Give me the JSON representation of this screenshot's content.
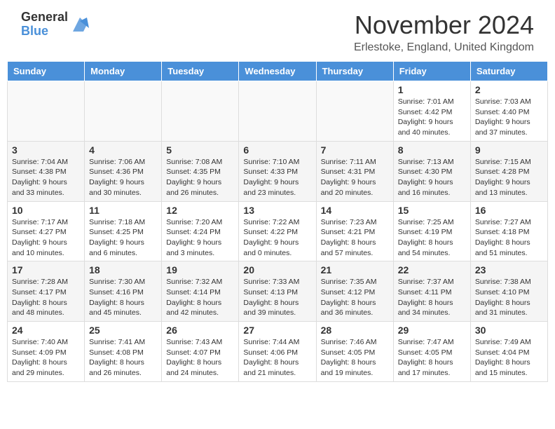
{
  "logo": {
    "general": "General",
    "blue": "Blue"
  },
  "title": "November 2024",
  "location": "Erlestoke, England, United Kingdom",
  "headers": [
    "Sunday",
    "Monday",
    "Tuesday",
    "Wednesday",
    "Thursday",
    "Friday",
    "Saturday"
  ],
  "weeks": [
    [
      {
        "day": "",
        "info": ""
      },
      {
        "day": "",
        "info": ""
      },
      {
        "day": "",
        "info": ""
      },
      {
        "day": "",
        "info": ""
      },
      {
        "day": "",
        "info": ""
      },
      {
        "day": "1",
        "info": "Sunrise: 7:01 AM\nSunset: 4:42 PM\nDaylight: 9 hours\nand 40 minutes."
      },
      {
        "day": "2",
        "info": "Sunrise: 7:03 AM\nSunset: 4:40 PM\nDaylight: 9 hours\nand 37 minutes."
      }
    ],
    [
      {
        "day": "3",
        "info": "Sunrise: 7:04 AM\nSunset: 4:38 PM\nDaylight: 9 hours\nand 33 minutes."
      },
      {
        "day": "4",
        "info": "Sunrise: 7:06 AM\nSunset: 4:36 PM\nDaylight: 9 hours\nand 30 minutes."
      },
      {
        "day": "5",
        "info": "Sunrise: 7:08 AM\nSunset: 4:35 PM\nDaylight: 9 hours\nand 26 minutes."
      },
      {
        "day": "6",
        "info": "Sunrise: 7:10 AM\nSunset: 4:33 PM\nDaylight: 9 hours\nand 23 minutes."
      },
      {
        "day": "7",
        "info": "Sunrise: 7:11 AM\nSunset: 4:31 PM\nDaylight: 9 hours\nand 20 minutes."
      },
      {
        "day": "8",
        "info": "Sunrise: 7:13 AM\nSunset: 4:30 PM\nDaylight: 9 hours\nand 16 minutes."
      },
      {
        "day": "9",
        "info": "Sunrise: 7:15 AM\nSunset: 4:28 PM\nDaylight: 9 hours\nand 13 minutes."
      }
    ],
    [
      {
        "day": "10",
        "info": "Sunrise: 7:17 AM\nSunset: 4:27 PM\nDaylight: 9 hours\nand 10 minutes."
      },
      {
        "day": "11",
        "info": "Sunrise: 7:18 AM\nSunset: 4:25 PM\nDaylight: 9 hours\nand 6 minutes."
      },
      {
        "day": "12",
        "info": "Sunrise: 7:20 AM\nSunset: 4:24 PM\nDaylight: 9 hours\nand 3 minutes."
      },
      {
        "day": "13",
        "info": "Sunrise: 7:22 AM\nSunset: 4:22 PM\nDaylight: 9 hours\nand 0 minutes."
      },
      {
        "day": "14",
        "info": "Sunrise: 7:23 AM\nSunset: 4:21 PM\nDaylight: 8 hours\nand 57 minutes."
      },
      {
        "day": "15",
        "info": "Sunrise: 7:25 AM\nSunset: 4:19 PM\nDaylight: 8 hours\nand 54 minutes."
      },
      {
        "day": "16",
        "info": "Sunrise: 7:27 AM\nSunset: 4:18 PM\nDaylight: 8 hours\nand 51 minutes."
      }
    ],
    [
      {
        "day": "17",
        "info": "Sunrise: 7:28 AM\nSunset: 4:17 PM\nDaylight: 8 hours\nand 48 minutes."
      },
      {
        "day": "18",
        "info": "Sunrise: 7:30 AM\nSunset: 4:16 PM\nDaylight: 8 hours\nand 45 minutes."
      },
      {
        "day": "19",
        "info": "Sunrise: 7:32 AM\nSunset: 4:14 PM\nDaylight: 8 hours\nand 42 minutes."
      },
      {
        "day": "20",
        "info": "Sunrise: 7:33 AM\nSunset: 4:13 PM\nDaylight: 8 hours\nand 39 minutes."
      },
      {
        "day": "21",
        "info": "Sunrise: 7:35 AM\nSunset: 4:12 PM\nDaylight: 8 hours\nand 36 minutes."
      },
      {
        "day": "22",
        "info": "Sunrise: 7:37 AM\nSunset: 4:11 PM\nDaylight: 8 hours\nand 34 minutes."
      },
      {
        "day": "23",
        "info": "Sunrise: 7:38 AM\nSunset: 4:10 PM\nDaylight: 8 hours\nand 31 minutes."
      }
    ],
    [
      {
        "day": "24",
        "info": "Sunrise: 7:40 AM\nSunset: 4:09 PM\nDaylight: 8 hours\nand 29 minutes."
      },
      {
        "day": "25",
        "info": "Sunrise: 7:41 AM\nSunset: 4:08 PM\nDaylight: 8 hours\nand 26 minutes."
      },
      {
        "day": "26",
        "info": "Sunrise: 7:43 AM\nSunset: 4:07 PM\nDaylight: 8 hours\nand 24 minutes."
      },
      {
        "day": "27",
        "info": "Sunrise: 7:44 AM\nSunset: 4:06 PM\nDaylight: 8 hours\nand 21 minutes."
      },
      {
        "day": "28",
        "info": "Sunrise: 7:46 AM\nSunset: 4:05 PM\nDaylight: 8 hours\nand 19 minutes."
      },
      {
        "day": "29",
        "info": "Sunrise: 7:47 AM\nSunset: 4:05 PM\nDaylight: 8 hours\nand 17 minutes."
      },
      {
        "day": "30",
        "info": "Sunrise: 7:49 AM\nSunset: 4:04 PM\nDaylight: 8 hours\nand 15 minutes."
      }
    ]
  ]
}
